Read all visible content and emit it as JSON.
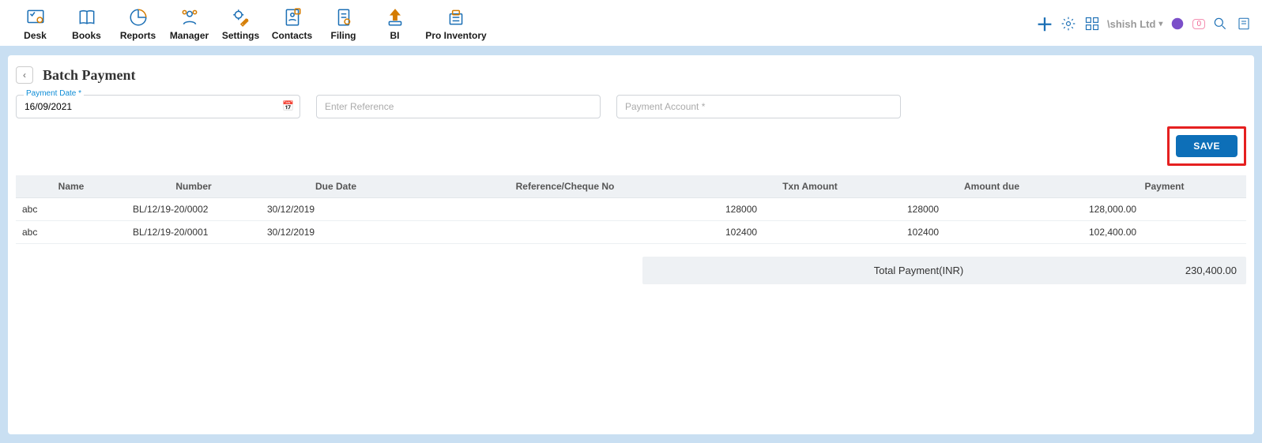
{
  "nav": {
    "items": [
      {
        "label": "Desk"
      },
      {
        "label": "Books"
      },
      {
        "label": "Reports"
      },
      {
        "label": "Manager"
      },
      {
        "label": "Settings"
      },
      {
        "label": "Contacts"
      },
      {
        "label": "Filing"
      },
      {
        "label": "BI"
      },
      {
        "label": "Pro Inventory"
      }
    ]
  },
  "topright": {
    "company": "\\shish Ltd",
    "notif_count": "0"
  },
  "page": {
    "title": "Batch Payment",
    "payment_date_label": "Payment Date *",
    "payment_date_value": "16/09/2021",
    "reference_placeholder": "Enter Reference",
    "account_placeholder": "Payment Account *",
    "save_label": "SAVE"
  },
  "table": {
    "headers": {
      "name": "Name",
      "number": "Number",
      "due_date": "Due Date",
      "ref": "Reference/Cheque No",
      "txn": "Txn Amount",
      "due": "Amount due",
      "payment": "Payment"
    },
    "rows": [
      {
        "name": "abc",
        "number": "BL/12/19-20/0002",
        "due_date": "30/12/2019",
        "ref": "",
        "txn": "128000",
        "due": "128000",
        "payment": "128,000.00"
      },
      {
        "name": "abc",
        "number": "BL/12/19-20/0001",
        "due_date": "30/12/2019",
        "ref": "",
        "txn": "102400",
        "due": "102400",
        "payment": "102,400.00"
      }
    ]
  },
  "totals": {
    "label": "Total Payment(INR)",
    "value": "230,400.00"
  }
}
